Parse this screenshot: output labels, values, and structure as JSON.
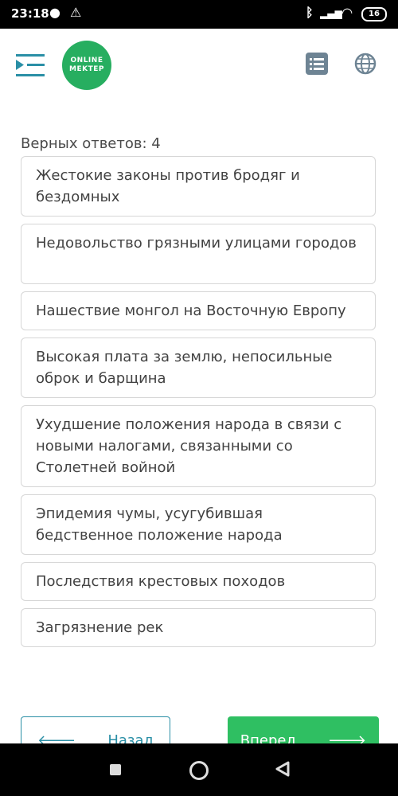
{
  "status": {
    "time": "23:18",
    "battery": "16"
  },
  "header": {
    "logo_line1": "ONLINE",
    "logo_line2": "MEKTEP"
  },
  "answers_label": "Верных ответов: 4",
  "options": [
    "Жестокие законы против бродяг и бездомных",
    "Недовольство грязными улицами городов",
    "Нашествие монгол на Восточную Европу",
    "Высокая плата за землю, непосильные оброк и барщина",
    "Ухудшение положения народа в связи с новыми налогами, связанными со Столетней войной",
    "Эпидемия чумы, усугубившая бедственное положение народа",
    "Последствия крестовых походов",
    "Загрязнение рек"
  ],
  "nav": {
    "back_label": "Назад",
    "next_label": "Вперед"
  },
  "colors": {
    "accent_green": "#2fbf62",
    "logo_green": "#27ae60",
    "back_border": "#2a8fa6"
  }
}
